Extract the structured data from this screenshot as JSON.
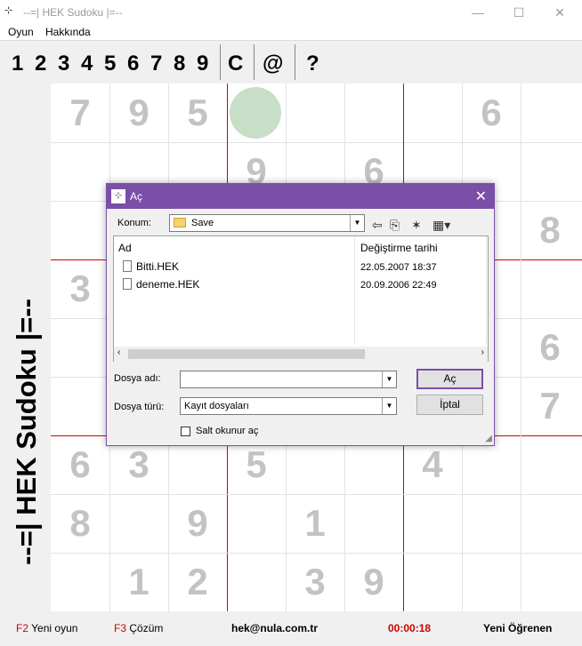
{
  "window": {
    "title": "--=| HEK Sudoku |=--",
    "minimize": "—",
    "maximize": "☐",
    "close": "✕"
  },
  "menu": {
    "game": "Oyun",
    "about": "Hakkında"
  },
  "toolbar": {
    "digits": [
      "1",
      "2",
      "3",
      "4",
      "5",
      "6",
      "7",
      "8",
      "9"
    ],
    "clear": "C",
    "at": "@",
    "help": "?"
  },
  "side_title": "--=| HEK Sudoku |=--",
  "board": {
    "cells": [
      {
        "row": 0,
        "col": 0,
        "value": "7"
      },
      {
        "row": 0,
        "col": 1,
        "value": "9"
      },
      {
        "row": 0,
        "col": 2,
        "value": "5"
      },
      {
        "row": 0,
        "col": 7,
        "value": "6"
      },
      {
        "row": 1,
        "col": 3,
        "value": "9"
      },
      {
        "row": 1,
        "col": 5,
        "value": "6"
      },
      {
        "row": 2,
        "col": 8,
        "value": "8"
      },
      {
        "row": 3,
        "col": 0,
        "value": "3"
      },
      {
        "row": 4,
        "col": 8,
        "value": "6"
      },
      {
        "row": 5,
        "col": 8,
        "value": "7"
      },
      {
        "row": 6,
        "col": 0,
        "value": "6"
      },
      {
        "row": 6,
        "col": 1,
        "value": "3"
      },
      {
        "row": 6,
        "col": 3,
        "value": "5"
      },
      {
        "row": 6,
        "col": 6,
        "value": "4"
      },
      {
        "row": 7,
        "col": 0,
        "value": "8"
      },
      {
        "row": 7,
        "col": 2,
        "value": "9"
      },
      {
        "row": 7,
        "col": 4,
        "value": "1"
      },
      {
        "row": 8,
        "col": 1,
        "value": "1"
      },
      {
        "row": 8,
        "col": 2,
        "value": "2"
      },
      {
        "row": 8,
        "col": 4,
        "value": "3"
      },
      {
        "row": 8,
        "col": 5,
        "value": "9"
      }
    ],
    "highlight_color": "#c6dfc6",
    "digit_color": "#c3c3c3",
    "block_line_color": "#d60000"
  },
  "status": {
    "f2_key": "F2",
    "f2_label": "Yeni oyun",
    "f3_key": "F3",
    "f3_label": "Çözüm",
    "email": "hek@nula.com.tr",
    "timer": "00:00:18",
    "level": "Yeni Öğrenen"
  },
  "dialog": {
    "title": "Aç",
    "location_label": "Konum:",
    "location_value": "Save",
    "col_name": "Ad",
    "col_date": "Değiştirme tarihi",
    "files": [
      {
        "name": "Bitti.HEK",
        "date": "22.05.2007 18:37"
      },
      {
        "name": "deneme.HEK",
        "date": "20.09.2006 22:49"
      }
    ],
    "filename_label": "Dosya adı:",
    "filename_value": "",
    "filetype_label": "Dosya türü:",
    "filetype_value": "Kayıt dosyaları",
    "open_button": "Aç",
    "cancel_button": "İptal",
    "readonly_label": "Salt okunur aç",
    "accent_color": "#7b4ea8"
  }
}
